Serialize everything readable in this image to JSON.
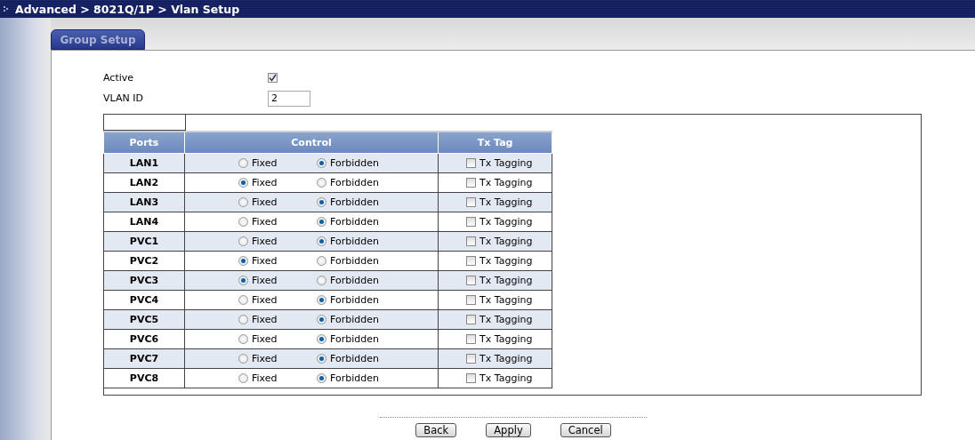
{
  "breadcrumb": "Advanced > 8021Q/1P > Vlan Setup",
  "tabs": [
    {
      "label": "Group Setup",
      "selected": true
    }
  ],
  "form": {
    "active": {
      "label": "Active",
      "checked": true
    },
    "vlan_id": {
      "label": "VLAN ID",
      "value": "2"
    }
  },
  "table": {
    "columns": [
      "Ports",
      "Control",
      "Tx Tag"
    ],
    "rows": [
      {
        "port": "LAN1",
        "control": [
          {
            "label": "Fixed",
            "selected": false
          },
          {
            "label": "Forbidden",
            "selected": true
          }
        ],
        "tx_tag": {
          "label": "Tx Tagging",
          "checked": false
        }
      },
      {
        "port": "LAN2",
        "control": [
          {
            "label": "Fixed",
            "selected": true
          },
          {
            "label": "Forbidden",
            "selected": false
          }
        ],
        "tx_tag": {
          "label": "Tx Tagging",
          "checked": false
        }
      },
      {
        "port": "LAN3",
        "control": [
          {
            "label": "Fixed",
            "selected": false
          },
          {
            "label": "Forbidden",
            "selected": true
          }
        ],
        "tx_tag": {
          "label": "Tx Tagging",
          "checked": false
        }
      },
      {
        "port": "LAN4",
        "control": [
          {
            "label": "Fixed",
            "selected": false
          },
          {
            "label": "Forbidden",
            "selected": true
          }
        ],
        "tx_tag": {
          "label": "Tx Tagging",
          "checked": false
        }
      },
      {
        "port": "PVC1",
        "control": [
          {
            "label": "Fixed",
            "selected": false
          },
          {
            "label": "Forbidden",
            "selected": true
          }
        ],
        "tx_tag": {
          "label": "Tx Tagging",
          "checked": false
        }
      },
      {
        "port": "PVC2",
        "control": [
          {
            "label": "Fixed",
            "selected": true
          },
          {
            "label": "Forbidden",
            "selected": false
          }
        ],
        "tx_tag": {
          "label": "Tx Tagging",
          "checked": false
        }
      },
      {
        "port": "PVC3",
        "control": [
          {
            "label": "Fixed",
            "selected": true
          },
          {
            "label": "Forbidden",
            "selected": false
          }
        ],
        "tx_tag": {
          "label": "Tx Tagging",
          "checked": false
        }
      },
      {
        "port": "PVC4",
        "control": [
          {
            "label": "Fixed",
            "selected": false
          },
          {
            "label": "Forbidden",
            "selected": true
          }
        ],
        "tx_tag": {
          "label": "Tx Tagging",
          "checked": false
        }
      },
      {
        "port": "PVC5",
        "control": [
          {
            "label": "Fixed",
            "selected": false
          },
          {
            "label": "Forbidden",
            "selected": true
          }
        ],
        "tx_tag": {
          "label": "Tx Tagging",
          "checked": false
        }
      },
      {
        "port": "PVC6",
        "control": [
          {
            "label": "Fixed",
            "selected": false
          },
          {
            "label": "Forbidden",
            "selected": true
          }
        ],
        "tx_tag": {
          "label": "Tx Tagging",
          "checked": false
        }
      },
      {
        "port": "PVC7",
        "control": [
          {
            "label": "Fixed",
            "selected": false
          },
          {
            "label": "Forbidden",
            "selected": true
          }
        ],
        "tx_tag": {
          "label": "Tx Tagging",
          "checked": false
        }
      },
      {
        "port": "PVC8",
        "control": [
          {
            "label": "Fixed",
            "selected": false
          },
          {
            "label": "Forbidden",
            "selected": true
          }
        ],
        "tx_tag": {
          "label": "Tx Tagging",
          "checked": false
        }
      }
    ]
  },
  "buttons": [
    "Back",
    "Apply",
    "Cancel"
  ]
}
